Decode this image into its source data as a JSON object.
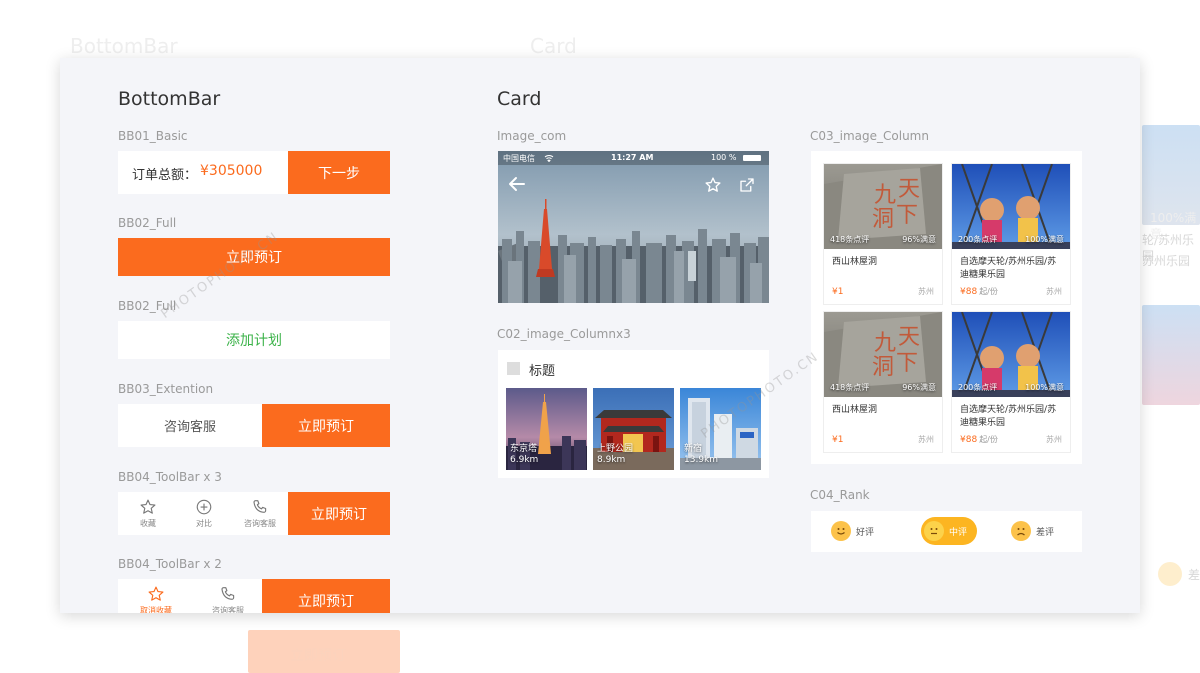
{
  "ghost": {
    "left_title": "BottomBar",
    "right_title": "Card",
    "book_label": "立即预订",
    "right_caption": "100%满意",
    "right_names": "轮/苏州乐园",
    "right_extra": "苏州乐园",
    "right_rank": "差"
  },
  "bottombar": {
    "title": "BottomBar",
    "bb01": {
      "label": "BB01_Basic",
      "total_label": "订单总额：",
      "total_value": "¥305000",
      "next_label": "下一步"
    },
    "bb02_full": {
      "label": "BB02_Full",
      "book_label": "立即预订"
    },
    "bb02_full_plan": {
      "label": "BB02_Full",
      "plan_label": "添加计划"
    },
    "bb03": {
      "label": "BB03_Extention",
      "consult_label": "咨询客服",
      "book_label": "立即预订"
    },
    "bb04_3": {
      "label": "BB04_ToolBar x 3",
      "fav_label": "收藏",
      "compare_label": "对比",
      "consult_label": "咨询客服",
      "book_label": "立即预订"
    },
    "bb04_2": {
      "label": "BB04_ToolBar x 2",
      "fav_label": "取消收藏",
      "consult_label": "咨询客服",
      "book_label": "立即预订"
    }
  },
  "card": {
    "title": "Card",
    "image_com": {
      "label": "Image_com",
      "carrier": "中国电信",
      "time": "11:27 AM",
      "battery": "100 %"
    },
    "c02": {
      "label": "C02_image_Columnx3",
      "header": "标题",
      "items": [
        {
          "name": "东京塔",
          "distance": "6.9km"
        },
        {
          "name": "上野公园",
          "distance": "8.9km"
        },
        {
          "name": "新宿",
          "distance": "13.9km"
        }
      ]
    },
    "c03": {
      "label": "C03_image_Column",
      "items": [
        {
          "reviews": "418条点评",
          "satisfaction": "96%满意",
          "name": "西山林屋洞",
          "price": "¥1",
          "unit": "",
          "city": "苏州"
        },
        {
          "reviews": "200条点评",
          "satisfaction": "100%满意",
          "name": "自选摩天轮/苏州乐园/苏迪糖果乐园",
          "price": "¥88",
          "unit": "起/份",
          "city": "苏州"
        },
        {
          "reviews": "418条点评",
          "satisfaction": "96%满意",
          "name": "西山林屋洞",
          "price": "¥1",
          "unit": "",
          "city": "苏州"
        },
        {
          "reviews": "200条点评",
          "satisfaction": "100%满意",
          "name": "自选摩天轮/苏州乐园/苏迪糖果乐园",
          "price": "¥88",
          "unit": "起/份",
          "city": "苏州"
        }
      ]
    },
    "c04": {
      "label": "C04_Rank",
      "good": "好评",
      "medium": "中评",
      "bad": "差评"
    }
  },
  "watermark": "PHOTOPHOTO.CN",
  "colors": {
    "accent": "#fb6b1e",
    "plan_text": "#3cb34a",
    "rank_selected": "#fcb521"
  }
}
